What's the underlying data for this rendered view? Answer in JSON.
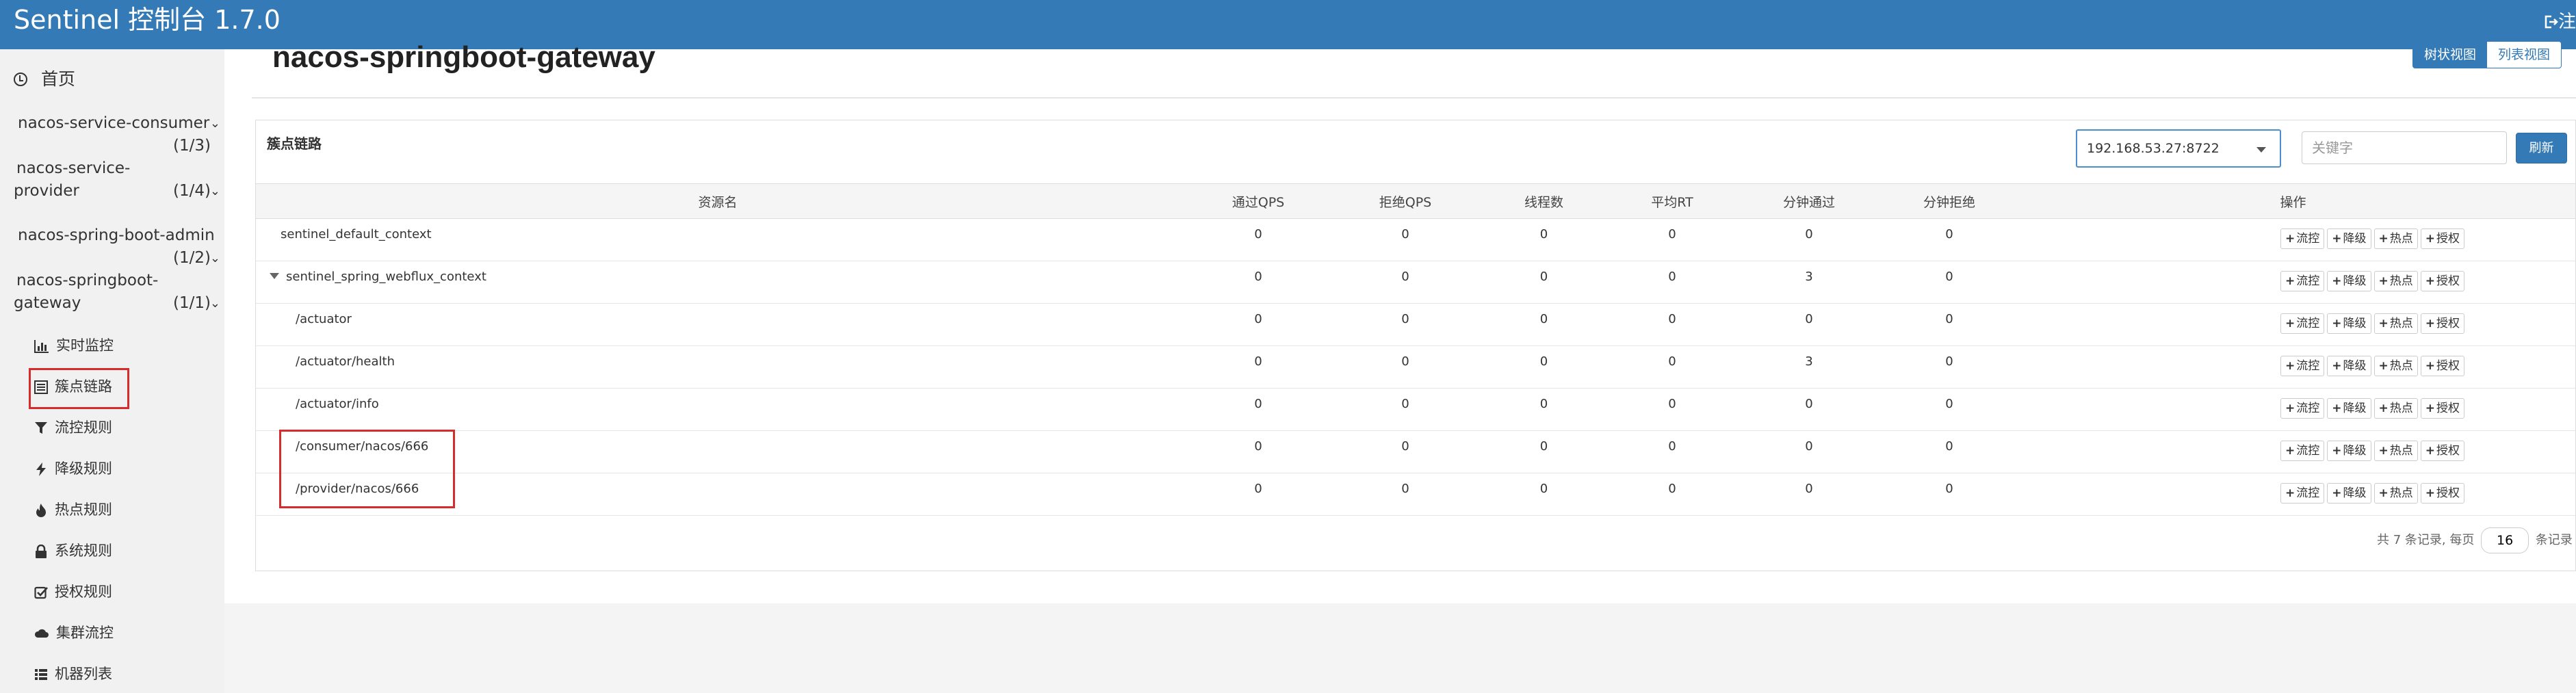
{
  "header": {
    "brand": "Sentinel 控制台 1.7.0",
    "logout_label": "注",
    "colors": {
      "bar": "#337ab7",
      "text": "#ffffff"
    }
  },
  "sidebar": {
    "home": {
      "label": "首页",
      "icon": "dashboard-icon"
    },
    "apps": [
      {
        "name": "nacos-service-consumer",
        "count": "(1/3)"
      },
      {
        "name_line1": "nacos-service-",
        "name_line2": "provider",
        "count": "(1/4)"
      },
      {
        "name": "nacos-spring-boot-admin",
        "count": "(1/2)"
      },
      {
        "name_line1": "nacos-springboot-",
        "name_line2": "gateway",
        "count": "(1/1)"
      }
    ],
    "menu": [
      {
        "label": "实时监控",
        "icon": "bar-chart-icon"
      },
      {
        "label": "簇点链路",
        "icon": "list-alt-icon",
        "highlighted": true
      },
      {
        "label": "流控规则",
        "icon": "filter-icon"
      },
      {
        "label": "降级规则",
        "icon": "bolt-icon"
      },
      {
        "label": "热点规则",
        "icon": "fire-icon"
      },
      {
        "label": "系统规则",
        "icon": "lock-icon"
      },
      {
        "label": "授权规则",
        "icon": "check-square-icon"
      },
      {
        "label": "集群流控",
        "icon": "cloud-icon"
      },
      {
        "label": "机器列表",
        "icon": "th-list-icon"
      }
    ]
  },
  "main": {
    "title": "nacos-springboot-gateway",
    "view_tree_label": "树状视图",
    "view_list_label": "列表视图",
    "panel_title": "簇点链路",
    "machine_select": "192.168.53.27:8722",
    "search_placeholder": "关键字",
    "refresh_label": "刷新",
    "columns": [
      "资源名",
      "通过QPS",
      "拒绝QPS",
      "线程数",
      "平均RT",
      "分钟通过",
      "分钟拒绝",
      "操作"
    ],
    "op_labels": [
      "流控",
      "降级",
      "热点",
      "授权"
    ],
    "rows": [
      {
        "name": "sentinel_default_context",
        "pass_qps": "0",
        "block_qps": "0",
        "threads": "0",
        "avg_rt": "0",
        "min_pass": "0",
        "min_block": "0"
      },
      {
        "name": "sentinel_spring_webflux_context",
        "pass_qps": "0",
        "block_qps": "0",
        "threads": "0",
        "avg_rt": "0",
        "min_pass": "3",
        "min_block": "0",
        "expanded": true
      },
      {
        "name": "/actuator",
        "pass_qps": "0",
        "block_qps": "0",
        "threads": "0",
        "avg_rt": "0",
        "min_pass": "0",
        "min_block": "0"
      },
      {
        "name": "/actuator/health",
        "pass_qps": "0",
        "block_qps": "0",
        "threads": "0",
        "avg_rt": "0",
        "min_pass": "3",
        "min_block": "0"
      },
      {
        "name": "/actuator/info",
        "pass_qps": "0",
        "block_qps": "0",
        "threads": "0",
        "avg_rt": "0",
        "min_pass": "0",
        "min_block": "0"
      },
      {
        "name": "/consumer/nacos/666",
        "pass_qps": "0",
        "block_qps": "0",
        "threads": "0",
        "avg_rt": "0",
        "min_pass": "0",
        "min_block": "0"
      },
      {
        "name": "/provider/nacos/666",
        "pass_qps": "0",
        "block_qps": "0",
        "threads": "0",
        "avg_rt": "0",
        "min_pass": "0",
        "min_block": "0"
      }
    ],
    "pager": {
      "prefix": "共 7 条记录, 每页",
      "page_size": "16",
      "suffix": "条记录"
    }
  }
}
